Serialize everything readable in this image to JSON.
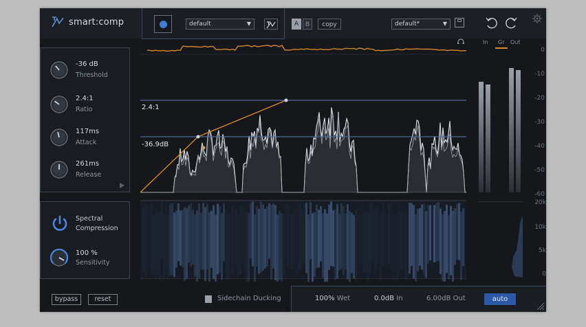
{
  "app": {
    "title": "smart:comp"
  },
  "preset": {
    "bank_value": "default",
    "ab_a": "A",
    "ab_b": "B",
    "copy_label": "copy",
    "preset_value": "default*"
  },
  "meters": {
    "tabs": [
      "In",
      "Gr",
      "Out"
    ],
    "active_tab": "Gr",
    "scale": [
      "0",
      "-10",
      "-20",
      "-30",
      "-40",
      "-50",
      "-60"
    ],
    "freq_scale": [
      "20k",
      "10k",
      "5k",
      "0"
    ],
    "in_level": 0.78,
    "gr_level": 0.82,
    "out_level": 0.88
  },
  "params": [
    {
      "id": "threshold",
      "value": "-36 dB",
      "label": "Threshold",
      "knob": 0.35
    },
    {
      "id": "ratio",
      "value": "2.4:1",
      "label": "Ratio",
      "knob": 0.3
    },
    {
      "id": "attack",
      "value": "117ms",
      "label": "Attack",
      "knob": 0.45
    },
    {
      "id": "release",
      "value": "261ms",
      "label": "Release",
      "knob": 0.5
    }
  ],
  "spectral": {
    "title_line1": "Spectral",
    "title_line2": "Compression",
    "sensitivity_value": "100 %",
    "sensitivity_label": "Sensitivity"
  },
  "graph": {
    "ratio_label": "2.4:1",
    "threshold_label": "-36.9dB"
  },
  "footer": {
    "bypass_label": "bypass",
    "reset_label": "reset",
    "sidechain_label": "Sidechain Ducking",
    "wet_value": "100%",
    "wet_label": "Wet",
    "in_value": "0.0dB",
    "in_label": "In",
    "out_value": "6.00dB",
    "out_label": "Out",
    "auto_label": "auto"
  },
  "colors": {
    "accent_orange": "#d4882a",
    "accent_blue": "#3e7cd6",
    "line_blue": "#4f6a9c"
  }
}
